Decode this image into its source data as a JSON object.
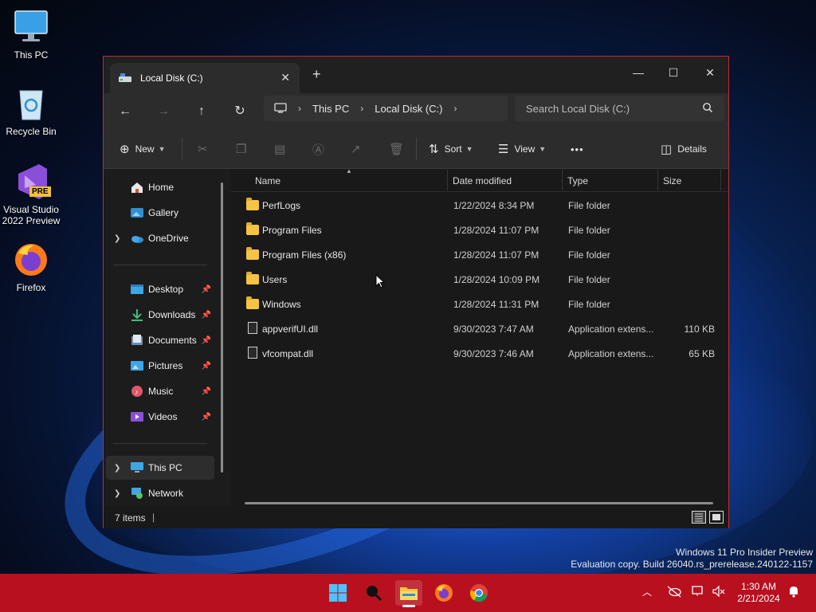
{
  "desktop": {
    "icons": [
      {
        "label": "This PC"
      },
      {
        "label": "Recycle Bin"
      },
      {
        "label": "Visual Studio 2022 Preview",
        "badge": "PRE"
      },
      {
        "label": "Firefox"
      }
    ],
    "watermark": {
      "line1": "Windows 11 Pro Insider Preview",
      "line2": "Evaluation copy. Build 26040.rs_prerelease.240122-1157"
    }
  },
  "window": {
    "tab_title": "Local Disk (C:)",
    "tab_close": "✕",
    "new_tab": "+",
    "controls": {
      "minimize": "—",
      "maximize": "☐",
      "close": "✕"
    },
    "nav": {
      "back": "←",
      "forward": "→",
      "up": "↑",
      "refresh": "↻"
    },
    "breadcrumb": [
      "This PC",
      "Local Disk (C:)"
    ],
    "search_placeholder": "Search Local Disk (C:)",
    "toolbar": {
      "new_label": "New",
      "sort_label": "Sort",
      "view_label": "View",
      "more_label": "•••",
      "details_label": "Details"
    },
    "sidebar": {
      "top": [
        {
          "label": "Home"
        },
        {
          "label": "Gallery"
        },
        {
          "label": "OneDrive"
        }
      ],
      "quick": [
        {
          "label": "Desktop"
        },
        {
          "label": "Downloads"
        },
        {
          "label": "Documents"
        },
        {
          "label": "Pictures"
        },
        {
          "label": "Music"
        },
        {
          "label": "Videos"
        }
      ],
      "bottom": [
        {
          "label": "This PC"
        },
        {
          "label": "Network"
        }
      ]
    },
    "columns": {
      "name": "Name",
      "date": "Date modified",
      "type": "Type",
      "size": "Size"
    },
    "files": [
      {
        "name": "PerfLogs",
        "date": "1/22/2024 8:34 PM",
        "type": "File folder",
        "size": ""
      },
      {
        "name": "Program Files",
        "date": "1/28/2024 11:07 PM",
        "type": "File folder",
        "size": ""
      },
      {
        "name": "Program Files (x86)",
        "date": "1/28/2024 11:07 PM",
        "type": "File folder",
        "size": ""
      },
      {
        "name": "Users",
        "date": "1/28/2024 10:09 PM",
        "type": "File folder",
        "size": ""
      },
      {
        "name": "Windows",
        "date": "1/28/2024 11:31 PM",
        "type": "File folder",
        "size": ""
      },
      {
        "name": "appverifUI.dll",
        "date": "9/30/2023 7:47 AM",
        "type": "Application extens...",
        "size": "110 KB"
      },
      {
        "name": "vfcompat.dll",
        "date": "9/30/2023 7:46 AM",
        "type": "Application extens...",
        "size": "65 KB"
      }
    ],
    "status": {
      "count": "7 items"
    }
  },
  "taskbar": {
    "clock_time": "1:30 AM",
    "clock_date": "2/21/2024"
  },
  "colors": {
    "taskbar": "#b8101f",
    "window_border": "#c42b2b",
    "folder": "#f6c443",
    "accent": "#0078d4"
  }
}
